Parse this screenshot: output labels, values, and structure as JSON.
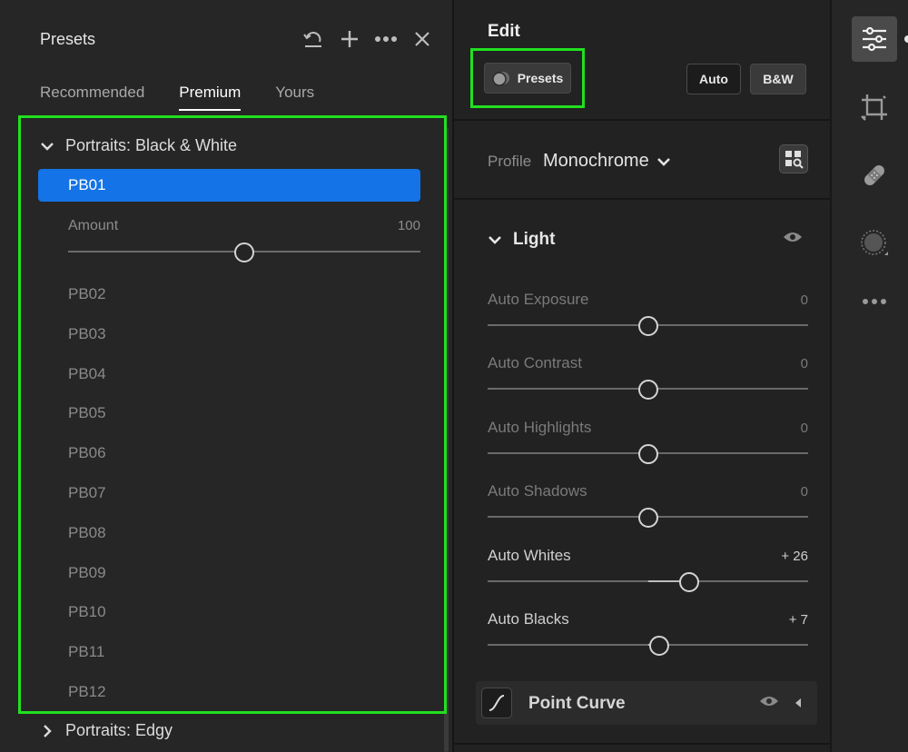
{
  "presets_panel": {
    "title": "Presets",
    "icons": [
      "undo-icon",
      "plus-icon",
      "more-icon",
      "close-icon"
    ],
    "tabs": [
      {
        "label": "Recommended",
        "active": false
      },
      {
        "label": "Premium",
        "active": true
      },
      {
        "label": "Yours",
        "active": false
      }
    ],
    "groups": [
      {
        "label": "Portraits: Black & White",
        "expanded": true
      },
      {
        "label": "Portraits: Edgy",
        "expanded": false
      }
    ],
    "selected_preset": "PB01",
    "amount": {
      "label": "Amount",
      "value": "100",
      "level": 0.5
    },
    "presets": [
      "PB02",
      "PB03",
      "PB04",
      "PB05",
      "PB06",
      "PB07",
      "PB08",
      "PB09",
      "PB10",
      "PB11",
      "PB12"
    ]
  },
  "edit_panel": {
    "title": "Edit",
    "presets_button": "Presets",
    "auto_button": "Auto",
    "bw_button": "B&W",
    "profile_label": "Profile",
    "profile_value": "Monochrome",
    "light_section": "Light",
    "adjustments": [
      {
        "label": "Auto Exposure",
        "value": "0",
        "level": 0.5,
        "active": false
      },
      {
        "label": "Auto Contrast",
        "value": "0",
        "level": 0.5,
        "active": false
      },
      {
        "label": "Auto Highlights",
        "value": "0",
        "level": 0.5,
        "active": false
      },
      {
        "label": "Auto Shadows",
        "value": "0",
        "level": 0.5,
        "active": false
      },
      {
        "label": "Auto Whites",
        "value": "+ 26",
        "level": 0.63,
        "active": true
      },
      {
        "label": "Auto Blacks",
        "value": "+ 7",
        "level": 0.535,
        "active": true
      }
    ],
    "point_curve": "Point Curve"
  },
  "tool_rail": {
    "tools": [
      "edit-sliders-icon",
      "crop-icon",
      "healing-bandage-icon",
      "masking-icon",
      "more-icon"
    ],
    "active_tool": "edit-sliders-icon"
  },
  "colors": {
    "selection_blue": "#1473e6",
    "highlight_green": "#21e01f",
    "panel_bg": "#262626"
  }
}
